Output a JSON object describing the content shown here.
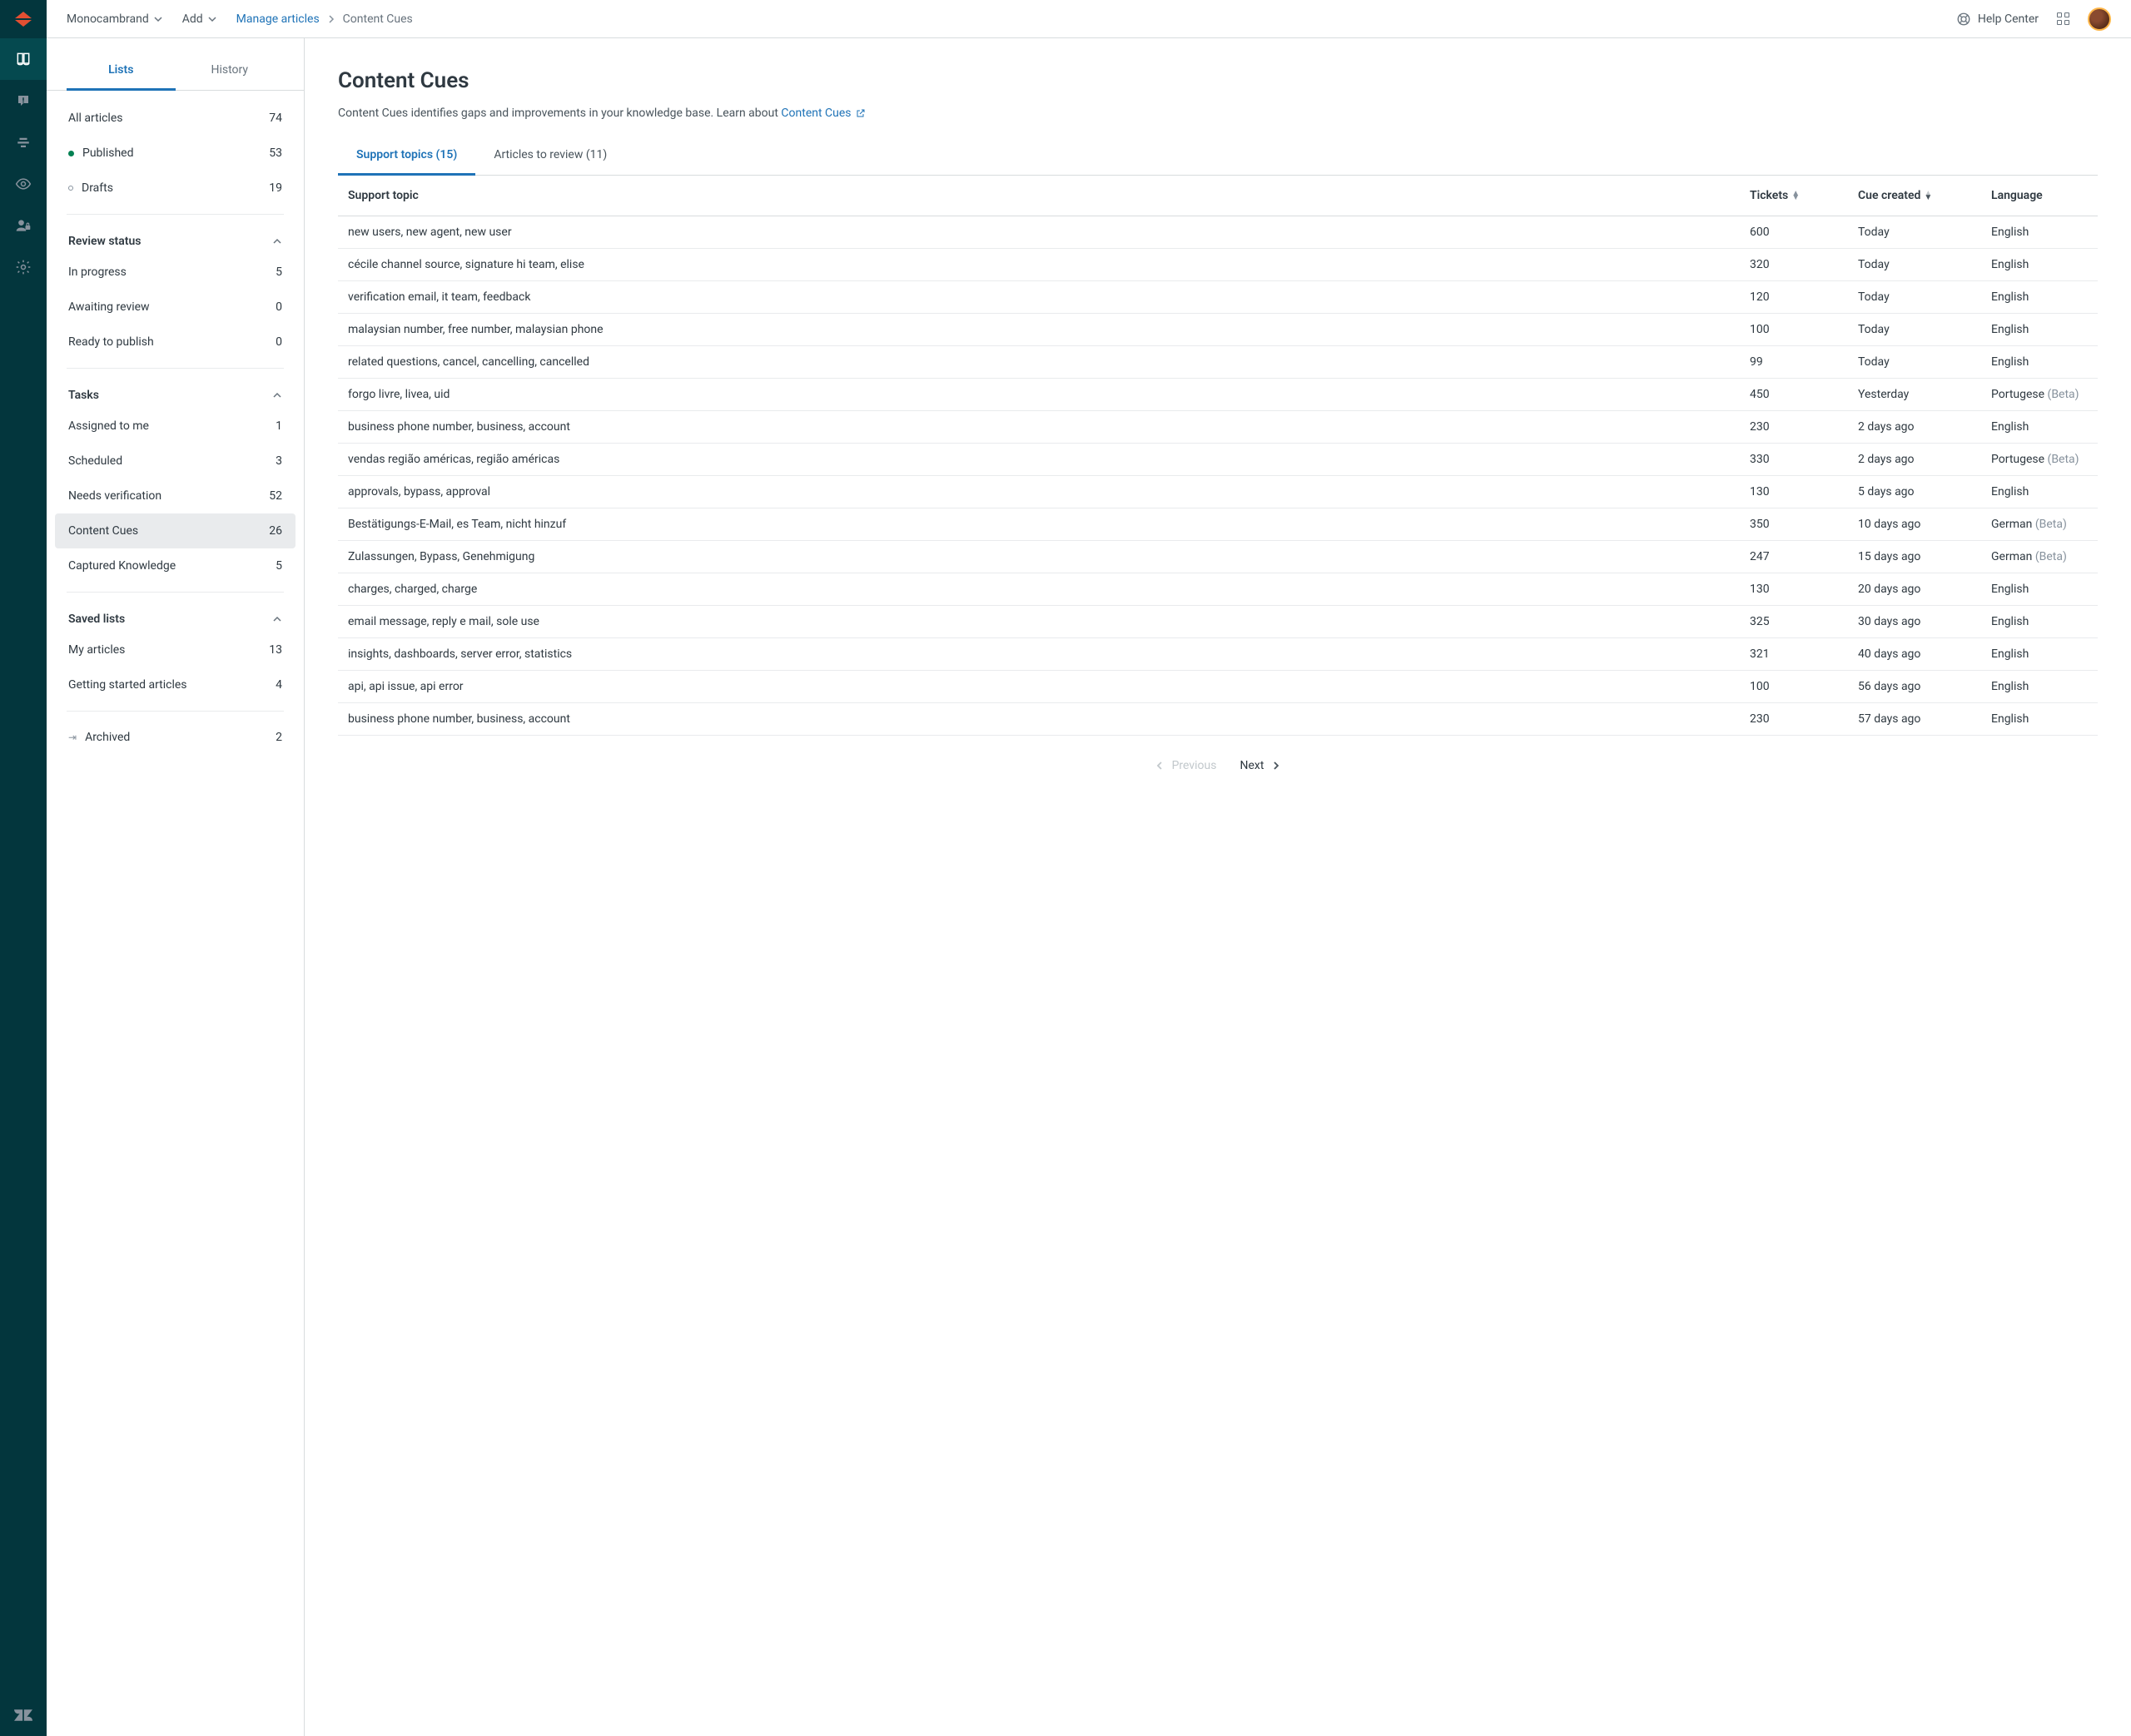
{
  "topbar": {
    "brand_dropdown": "Monocambrand",
    "add_label": "Add",
    "breadcrumb_link": "Manage articles",
    "breadcrumb_current": "Content Cues",
    "help_center": "Help Center"
  },
  "sidebar": {
    "tabs": {
      "lists": "Lists",
      "history": "History"
    },
    "articles": {
      "all_label": "All articles",
      "all_count": "74",
      "published_label": "Published",
      "published_count": "53",
      "drafts_label": "Drafts",
      "drafts_count": "19"
    },
    "review": {
      "header": "Review status",
      "in_progress_label": "In progress",
      "in_progress_count": "5",
      "awaiting_label": "Awaiting review",
      "awaiting_count": "0",
      "ready_label": "Ready to publish",
      "ready_count": "0"
    },
    "tasks": {
      "header": "Tasks",
      "assigned_label": "Assigned to me",
      "assigned_count": "1",
      "scheduled_label": "Scheduled",
      "scheduled_count": "3",
      "needs_label": "Needs verification",
      "needs_count": "52",
      "cues_label": "Content Cues",
      "cues_count": "26",
      "captured_label": "Captured Knowledge",
      "captured_count": "5"
    },
    "saved": {
      "header": "Saved lists",
      "my_label": "My articles",
      "my_count": "13",
      "getting_label": "Getting started articles",
      "getting_count": "4"
    },
    "archived_label": "Archived",
    "archived_count": "2"
  },
  "content": {
    "title": "Content Cues",
    "subtitle_prefix": "Content Cues identifies gaps and improvements in your knowledge base. Learn about ",
    "subtitle_link": "Content Cues",
    "tabs": {
      "support": "Support topics (15)",
      "review": "Articles to review (11)"
    },
    "columns": {
      "topic": "Support topic",
      "tickets": "Tickets",
      "created": "Cue created",
      "language": "Language"
    },
    "rows": [
      {
        "topic": "new users, new agent, new user",
        "tickets": "600",
        "created": "Today",
        "language": "English",
        "beta": ""
      },
      {
        "topic": "cécile channel source, signature hi team, elise",
        "tickets": "320",
        "created": "Today",
        "language": "English",
        "beta": ""
      },
      {
        "topic": "verification email, it team, feedback",
        "tickets": "120",
        "created": "Today",
        "language": "English",
        "beta": ""
      },
      {
        "topic": "malaysian number, free number, malaysian phone",
        "tickets": "100",
        "created": "Today",
        "language": "English",
        "beta": ""
      },
      {
        "topic": "related questions, cancel, cancelling, cancelled",
        "tickets": "99",
        "created": "Today",
        "language": "English",
        "beta": ""
      },
      {
        "topic": "forgo livre, livea, uid",
        "tickets": "450",
        "created": "Yesterday",
        "language": "Portugese",
        "beta": "(Beta)"
      },
      {
        "topic": "business phone number, business, account",
        "tickets": "230",
        "created": "2 days ago",
        "language": "English",
        "beta": ""
      },
      {
        "topic": "vendas região américas, região américas",
        "tickets": "330",
        "created": "2 days ago",
        "language": "Portugese",
        "beta": "(Beta)"
      },
      {
        "topic": "approvals, bypass, approval",
        "tickets": "130",
        "created": "5 days ago",
        "language": "English",
        "beta": ""
      },
      {
        "topic": "Bestätigungs-E-Mail, es Team, nicht hinzuf",
        "tickets": "350",
        "created": "10 days ago",
        "language": "German",
        "beta": "(Beta)"
      },
      {
        "topic": "Zulassungen, Bypass, Genehmigung",
        "tickets": "247",
        "created": "15 days ago",
        "language": "German",
        "beta": "(Beta)"
      },
      {
        "topic": "charges, charged, charge",
        "tickets": "130",
        "created": "20 days ago",
        "language": "English",
        "beta": ""
      },
      {
        "topic": "email message, reply e mail, sole use",
        "tickets": "325",
        "created": "30 days ago",
        "language": "English",
        "beta": ""
      },
      {
        "topic": "insights, dashboards, server error, statistics",
        "tickets": "321",
        "created": "40 days ago",
        "language": "English",
        "beta": ""
      },
      {
        "topic": "api, api issue, api error",
        "tickets": "100",
        "created": "56 days ago",
        "language": "English",
        "beta": ""
      },
      {
        "topic": "business phone number, business, account",
        "tickets": "230",
        "created": "57 days ago",
        "language": "English",
        "beta": ""
      }
    ],
    "pager": {
      "prev": "Previous",
      "next": "Next"
    }
  }
}
